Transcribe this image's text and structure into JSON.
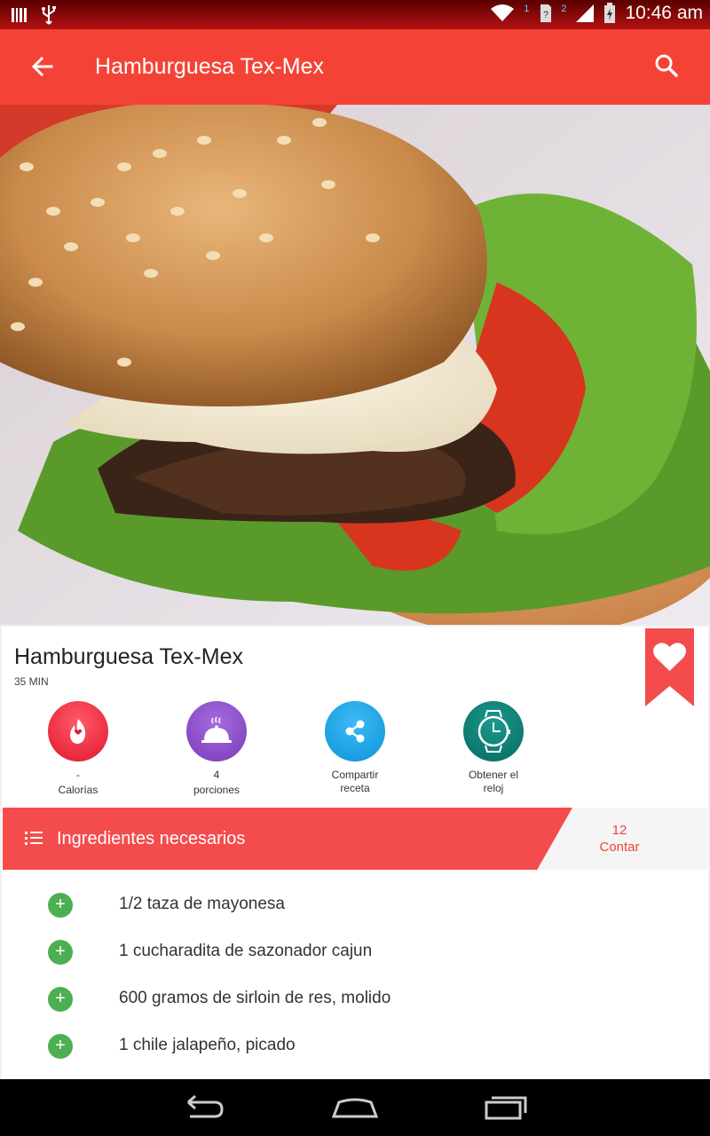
{
  "status_bar": {
    "time": "10:46 am",
    "sim_badge_1": "1",
    "sim_badge_2": "2"
  },
  "toolbar": {
    "title": "Hamburguesa Tex-Mex",
    "back_icon": "arrow-back-icon",
    "search_icon": "search-icon"
  },
  "recipe": {
    "title": "Hamburguesa Tex-Mex",
    "time": "35 MIN",
    "favorite_icon": "heart-icon"
  },
  "actions": [
    {
      "value": "-",
      "label": "Calorías",
      "color": "#f02d3a",
      "icon": "flame-icon"
    },
    {
      "value": "4",
      "label": "porciones",
      "color": "#8d4bc7",
      "icon": "serving-dish-icon"
    },
    {
      "value": "Compartir",
      "label": "receta",
      "color": "#1aa3e8",
      "icon": "share-icon"
    },
    {
      "value": "Obtener el",
      "label": "reloj",
      "color": "#0e7a70",
      "icon": "watch-icon"
    }
  ],
  "ingredients_section": {
    "title": "Ingredientes necesarios",
    "count": "12",
    "count_label": "Contar"
  },
  "ingredients": [
    "1/2 taza de mayonesa",
    "1 cucharadita de sazonador cajun",
    "600 gramos de sirloin de res, molido",
    "1 chile jalapeño, picado"
  ],
  "colors": {
    "primary": "#f44336",
    "add_green": "#4caf50"
  }
}
